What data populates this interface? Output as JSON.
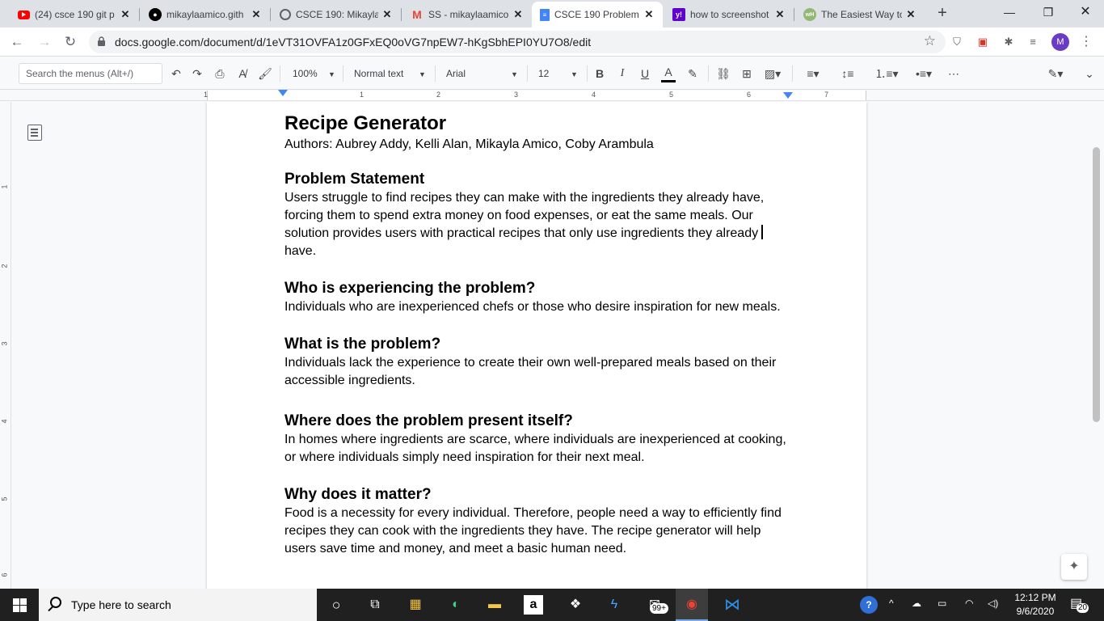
{
  "browser": {
    "tabs": [
      {
        "title": "(24) csce 190 git p",
        "favicon": "youtube-icon",
        "color": "#ff0000",
        "active": false
      },
      {
        "title": "mikaylaamico.gith",
        "favicon": "github-icon",
        "color": "#000000",
        "active": false
      },
      {
        "title": "CSCE 190: Mikayla",
        "favicon": "globe-icon",
        "color": "#5f6368",
        "active": false
      },
      {
        "title": "SS - mikaylaamico",
        "favicon": "gmail-icon",
        "color": "#ea4335",
        "active": false
      },
      {
        "title": "CSCE 190 Problem",
        "favicon": "docs-icon",
        "color": "#4285f4",
        "active": true
      },
      {
        "title": "how to screenshot",
        "favicon": "yahoo-icon",
        "color": "#6001d2",
        "active": false
      },
      {
        "title": "The Easiest Way to",
        "favicon": "wikihow-icon",
        "color": "#93b874",
        "active": false
      }
    ],
    "url": "docs.google.com/document/d/1eVT31OVFA1z0GFxEQ0oVG7npEW7-hKgSbhEPI0YU7O8/edit",
    "avatar_letter": "M"
  },
  "toolbar": {
    "search_placeholder": "Search the menus (Alt+/)",
    "zoom": "100%",
    "style": "Normal text",
    "font": "Arial",
    "font_size": "12"
  },
  "ruler": {
    "numbers": [
      "1",
      "1",
      "2",
      "3",
      "4",
      "5",
      "6",
      "7"
    ],
    "vertical_numbers": [
      "1",
      "2",
      "3",
      "4",
      "5",
      "6"
    ]
  },
  "document": {
    "title": "Recipe Generator",
    "authors": "Authors: Aubrey Addy, Kelli Alan, Mikayla Amico, Coby Arambula",
    "sections": [
      {
        "heading": "Problem Statement",
        "body_lines": [
          "Users struggle to find recipes they can make with the ingredients they already have,",
          "forcing them to spend extra money on food expenses, or eat the same meals. Our",
          "solution provides users with practical recipes that only use ingredients they already",
          "have."
        ]
      },
      {
        "heading": "Who is experiencing the problem?",
        "body_lines": [
          "Individuals who are inexperienced chefs or those who desire inspiration for new meals."
        ]
      },
      {
        "heading": "What is the problem?",
        "body_lines": [
          "Individuals lack the experience to create their own well-prepared meals based on their",
          "accessible ingredients."
        ]
      },
      {
        "heading": "Where does the problem present itself?",
        "body_lines": [
          "In homes where ingredients are scarce, where individuals are inexperienced at cooking,",
          "or where individuals simply need inspiration for their next meal."
        ]
      },
      {
        "heading": "Why does it matter?",
        "body_lines": [
          "Food is a necessity for every individual. Therefore, people need a way to efficiently find",
          "recipes they can cook with the ingredients they have. The recipe generator will help",
          "users save time and money, and meet a basic human need."
        ]
      }
    ]
  },
  "taskbar": {
    "search_placeholder": "Type here to search",
    "mail_badge": "99+",
    "time": "12:12 PM",
    "date": "9/6/2020",
    "notification_count": "20"
  }
}
